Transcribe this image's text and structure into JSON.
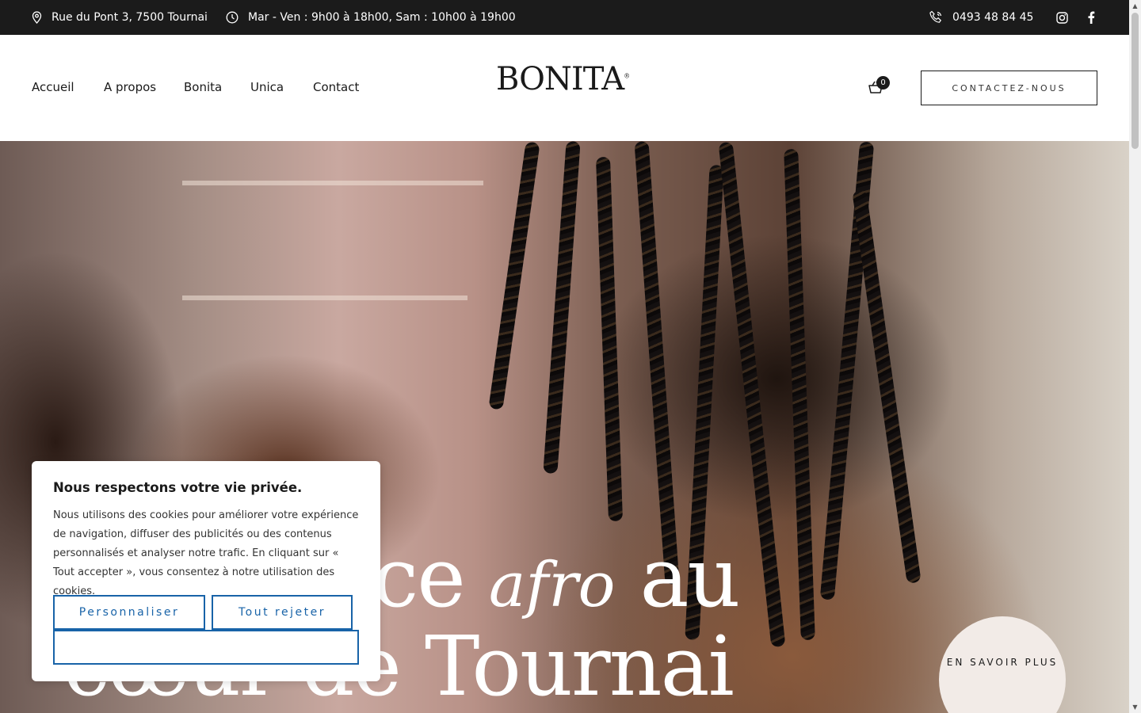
{
  "topbar": {
    "address": "Rue du Pont 3, 7500 Tournai",
    "hours": "Mar - Ven : 9h00 à 18h00, Sam : 10h00 à 19h00",
    "phone": "0493 48 84 45",
    "social": [
      "instagram-icon",
      "facebook-icon"
    ]
  },
  "nav": {
    "items": [
      "Accueil",
      "A propos",
      "Bonita",
      "Unica",
      "Contact"
    ]
  },
  "logo": {
    "text": "BONITA",
    "mark": "®"
  },
  "cart": {
    "count": "0"
  },
  "header": {
    "cta_label": "CONTACTEZ-NOUS"
  },
  "hero": {
    "line1_visible": "ace",
    "line1_script": "afro",
    "line1_end": "au",
    "line2_visible_start": "cœur",
    "line2_de": "de",
    "line2_end": "Tournai",
    "cta": "EN SAVOIR PLUS"
  },
  "cookie": {
    "title": "Nous respectons votre vie privée.",
    "body": "Nous utilisons des cookies pour améliorer votre expérience de navigation, diffuser des publicités ou des contenus personnalisés et analyser notre trafic. En cliquant sur « Tout accepter », vous consentez à notre utilisation des cookies.",
    "customize": "Personnaliser",
    "reject": "Tout rejeter",
    "accept": ""
  },
  "colors": {
    "topbar_bg": "#1b1b1b",
    "cookie_button": "#1863a8",
    "cta_circle": "#f2ebe7"
  }
}
